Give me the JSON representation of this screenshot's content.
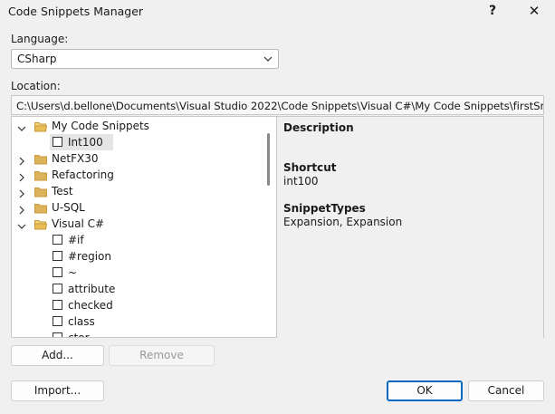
{
  "window": {
    "title": "Code Snippets Manager",
    "help_label": "?",
    "close_label": "✕"
  },
  "language": {
    "label": "Language:",
    "selected": "CSharp"
  },
  "location": {
    "label": "Location:",
    "path": "C:\\Users\\d.bellone\\Documents\\Visual Studio 2022\\Code Snippets\\Visual C#\\My Code Snippets\\firstSnippet.snippet"
  },
  "tree": {
    "items": [
      {
        "label": "My Code Snippets",
        "type": "folder",
        "expanded": true
      },
      {
        "label": "Int100",
        "type": "snippet",
        "selected": true
      },
      {
        "label": "NetFX30",
        "type": "folder",
        "expanded": false
      },
      {
        "label": "Refactoring",
        "type": "folder",
        "expanded": false
      },
      {
        "label": "Test",
        "type": "folder",
        "expanded": false
      },
      {
        "label": "U-SQL",
        "type": "folder",
        "expanded": false
      },
      {
        "label": "Visual C#",
        "type": "folder",
        "expanded": true
      },
      {
        "label": "#if",
        "type": "snippet"
      },
      {
        "label": "#region",
        "type": "snippet"
      },
      {
        "label": "~",
        "type": "snippet"
      },
      {
        "label": "attribute",
        "type": "snippet"
      },
      {
        "label": "checked",
        "type": "snippet"
      },
      {
        "label": "class",
        "type": "snippet"
      },
      {
        "label": "ctor",
        "type": "snippet"
      }
    ]
  },
  "details": {
    "description_header": "Description",
    "shortcut_header": "Shortcut",
    "shortcut_value": "int100",
    "snippet_types_header": "SnippetTypes",
    "snippet_types_value": "Expansion, Expansion"
  },
  "buttons": {
    "add": "Add...",
    "remove": "Remove",
    "import": "Import...",
    "ok": "OK",
    "cancel": "Cancel"
  },
  "colors": {
    "folder": "#dcb35c",
    "accent": "#0067c0"
  }
}
